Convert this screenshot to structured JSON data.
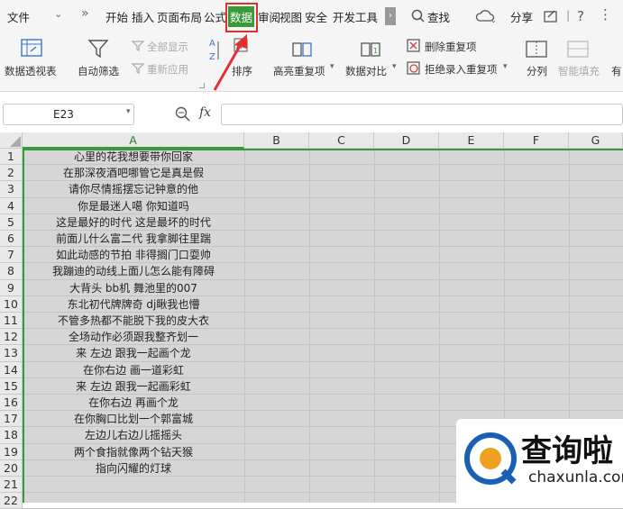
{
  "menu": {
    "file": "文件",
    "tabs": [
      "开始",
      "插入",
      "页面布局",
      "公式",
      "数据",
      "审阅",
      "视图",
      "安全",
      "开发工具"
    ],
    "search": "查找",
    "share": "分享"
  },
  "ribbon": {
    "pivot": "数据透视表",
    "autofilter": "自动筛选",
    "show_all": "全部显示",
    "reapply": "重新应用",
    "sort": "排序",
    "highlight_dup": "高亮重复项",
    "compare": "数据对比",
    "delete_dup": "删除重复项",
    "reject_dup": "拒绝录入重复项",
    "split": "分列",
    "smart_fill": "智能填充",
    "more": "有"
  },
  "namebox": {
    "value": "E23"
  },
  "formula": {
    "fx": "fx",
    "value": ""
  },
  "columns": [
    "A",
    "B",
    "C",
    "D",
    "E",
    "F",
    "G"
  ],
  "rows": [
    "1",
    "2",
    "3",
    "4",
    "5",
    "6",
    "7",
    "8",
    "9",
    "10",
    "11",
    "12",
    "13",
    "14",
    "15",
    "16",
    "17",
    "18",
    "19",
    "20",
    "21",
    "22"
  ],
  "cells_a": [
    "心里的花我想要带你回家",
    "在那深夜酒吧哪管它是真是假",
    "请你尽情摇摆忘记钟意的他",
    "你是最迷人噶 你知道吗",
    "这是最好的时代 这是最坏的时代",
    "前面儿什么富二代 我拿脚往里踹",
    "如此动感的节拍 非得搁门口耍帅",
    "我蹦迪的动线上面儿怎么能有障碍",
    "大背头 bb机 舞池里的007",
    "东北初代牌牌奇 dj瞅我也懵",
    "不管多热都不能脱下我的皮大衣",
    "全场动作必须跟我整齐划一",
    "来 左边 跟我一起画个龙",
    "在你右边 画一道彩虹",
    "来 左边 跟我一起画彩虹",
    "在你右边 再画个龙",
    "在你胸口比划一个郭富城",
    "左边儿右边儿摇摇头",
    "两个食指就像两个钻天猴",
    "指向闪耀的灯球",
    "",
    ""
  ],
  "watermark": {
    "title": "查询啦",
    "url": "chaxunla.com"
  },
  "colors": {
    "highlight": "#e03030",
    "tab_active_bg": "#3a9a3a",
    "grid_bg": "#d6d6d6"
  }
}
